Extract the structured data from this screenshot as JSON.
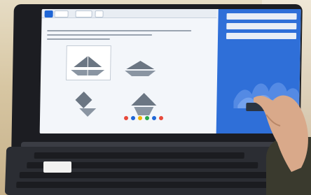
{
  "scene": {
    "description_colors": {
      "panel_blue": "#2f6fd8",
      "screen_bg": "#f3f6fa",
      "laptop_bezel": "#1c1d22",
      "skin": "#d9a98a"
    },
    "icons": [
      "finger-pointing-icon",
      "keyboard-icon",
      "laptop-icon"
    ]
  }
}
